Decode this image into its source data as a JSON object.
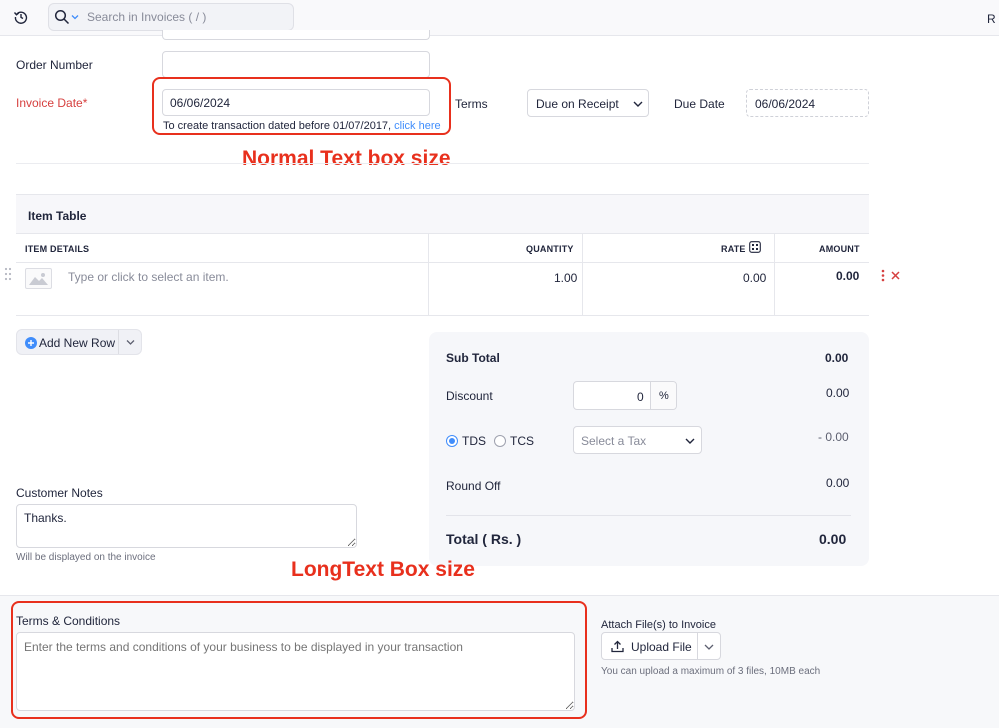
{
  "topbar": {
    "search_placeholder": "Search in Invoices ( / )",
    "right_text": "R"
  },
  "form": {
    "order_number_label": "Order Number",
    "order_number_value": "",
    "invoice_date_label": "Invoice Date",
    "invoice_date_required_mark": "*",
    "invoice_date_value": "06/06/2024",
    "transaction_hint": "To create transaction dated before 01/07/2017,",
    "click_here": "click here",
    "terms_label": "Terms",
    "terms_value": "Due on Receipt",
    "due_date_label": "Due Date",
    "due_date_value": "06/06/2024"
  },
  "annotations": {
    "normal_text": "Normal Text box size",
    "long_text": "LongText Box size"
  },
  "item_table": {
    "title": "Item Table",
    "columns": [
      "ITEM DETAILS",
      "QUANTITY",
      "RATE",
      "AMOUNT"
    ],
    "row": {
      "item_placeholder": "Type or click to select an item.",
      "quantity": "1.00",
      "rate": "0.00",
      "amount": "0.00"
    },
    "add_row_label": "Add New Row"
  },
  "summary": {
    "sub_total_label": "Sub Total",
    "sub_total_value": "0.00",
    "discount_label": "Discount",
    "discount_input": "0",
    "discount_unit": "%",
    "discount_value": "0.00",
    "tds_label": "TDS",
    "tcs_label": "TCS",
    "tax_placeholder": "Select a Tax",
    "tax_value": "- 0.00",
    "round_off_label": "Round Off",
    "round_off_value": "0.00",
    "total_label": "Total ( Rs. )",
    "total_value": "0.00"
  },
  "customer_notes": {
    "label": "Customer Notes",
    "value": "Thanks.",
    "hint": "Will be displayed on the invoice"
  },
  "terms_conditions": {
    "label": "Terms & Conditions",
    "placeholder": "Enter the terms and conditions of your business to be displayed in your transaction"
  },
  "attachments": {
    "label": "Attach File(s) to Invoice",
    "upload_label": "Upload File",
    "hint": "You can upload a maximum of 3 files, 10MB each"
  },
  "colors": {
    "accent": "#408dfb",
    "annotation_red": "#e8301d",
    "delete_red": "#d6403f"
  }
}
